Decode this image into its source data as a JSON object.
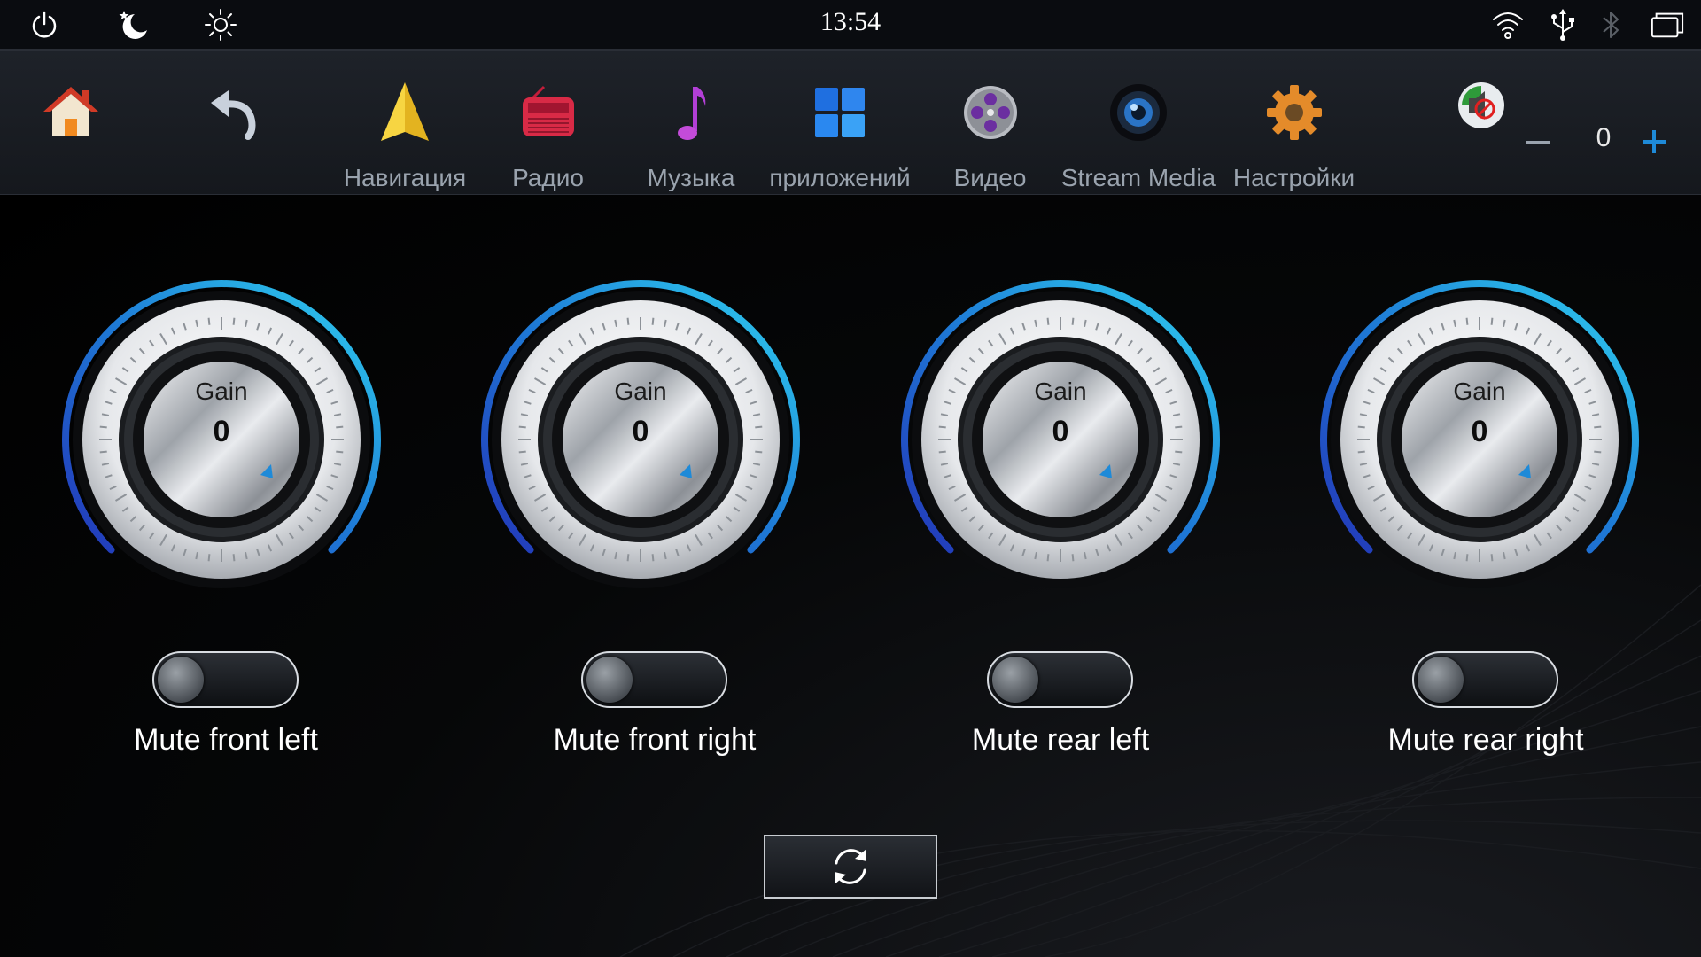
{
  "status_bar": {
    "time": "13:54",
    "icons": [
      "power-icon",
      "night-mode-icon",
      "brightness-icon",
      "wifi-icon",
      "usb-icon",
      "bluetooth-icon",
      "recent-apps-icon"
    ]
  },
  "apps": [
    {
      "id": "home",
      "icon": "home-icon",
      "label": ""
    },
    {
      "id": "back",
      "icon": "back-icon",
      "label": ""
    },
    {
      "id": "navigation",
      "icon": "navigation-icon",
      "label": "Навигация"
    },
    {
      "id": "radio",
      "icon": "radio-icon",
      "label": "Радио"
    },
    {
      "id": "music",
      "icon": "music-icon",
      "label": "Музыка"
    },
    {
      "id": "apps",
      "icon": "apps-grid-icon",
      "label": "приложений"
    },
    {
      "id": "video",
      "icon": "video-reel-icon",
      "label": "Видео"
    },
    {
      "id": "stream",
      "icon": "stream-media-icon",
      "label": "Stream Media"
    },
    {
      "id": "settings",
      "icon": "gear-icon",
      "label": "Настройки"
    }
  ],
  "volume": {
    "value": "0",
    "minus": "−",
    "plus": "+"
  },
  "channels": [
    {
      "gain_label": "Gain",
      "gain_value": "0",
      "mute_label": "Mute front left",
      "muted": false
    },
    {
      "gain_label": "Gain",
      "gain_value": "0",
      "mute_label": "Mute front right",
      "muted": false
    },
    {
      "gain_label": "Gain",
      "gain_value": "0",
      "mute_label": "Mute rear left",
      "muted": false
    },
    {
      "gain_label": "Gain",
      "gain_value": "0",
      "mute_label": "Mute rear right",
      "muted": false
    }
  ],
  "colors": {
    "accent": "#1e8ad8",
    "arc_start": "#2336b8",
    "arc_end": "#2fd2f0",
    "label_gray": "#9aa3ae"
  }
}
